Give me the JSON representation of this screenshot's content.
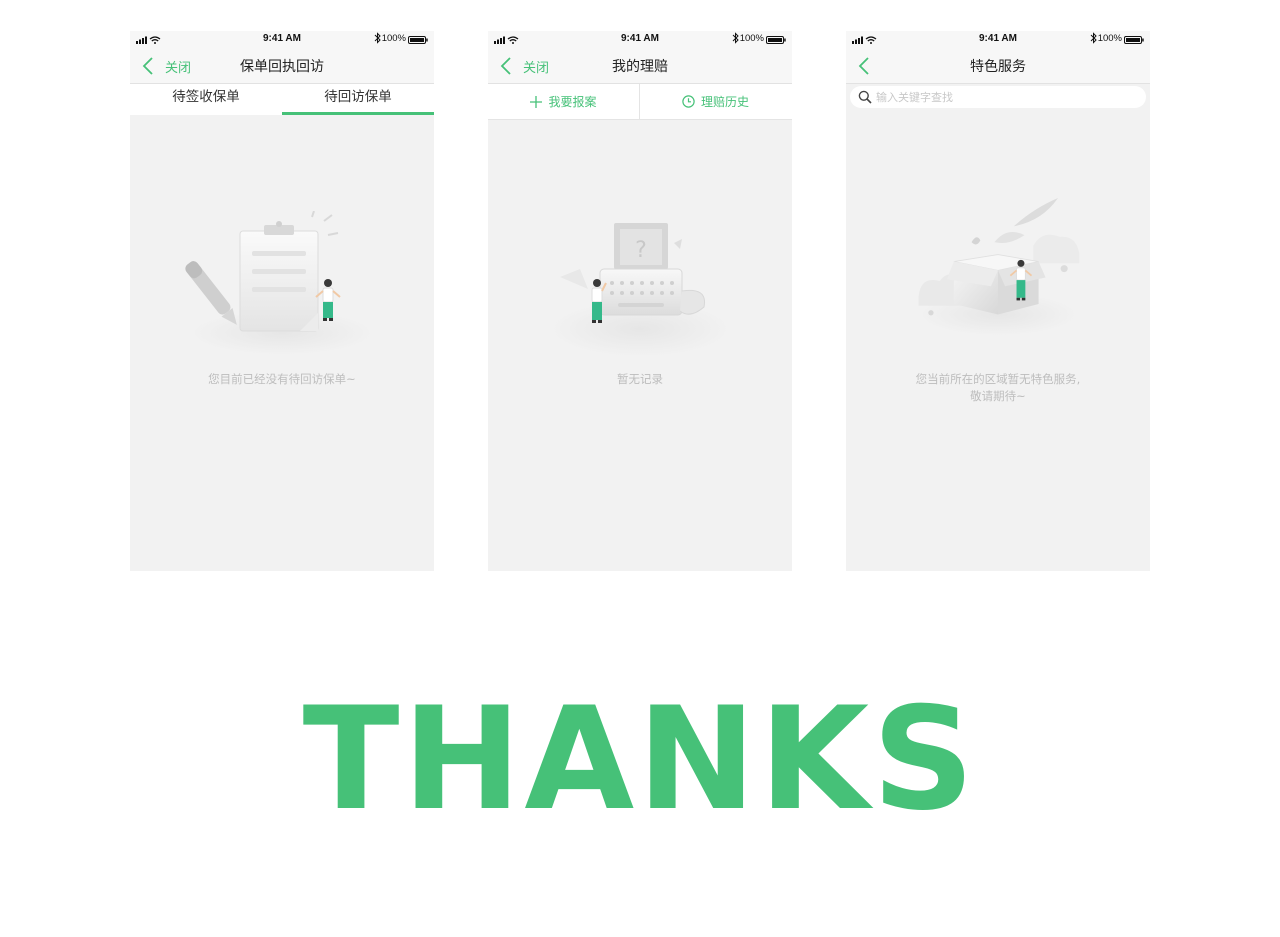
{
  "status_bar": {
    "time": "9:41 AM",
    "battery": "100%"
  },
  "colors": {
    "accent": "#46c178",
    "background": "#f2f2f2",
    "muted_text": "#bdbdbd"
  },
  "screen1": {
    "close_label": "关闭",
    "title": "保单回执回访",
    "tabs": [
      {
        "label": "待签收保单",
        "active": false
      },
      {
        "label": "待回访保单",
        "active": true
      }
    ],
    "empty_message": "您目前已经没有待回访保单~",
    "icons": {
      "back": "chevron-left-icon",
      "illustration": "clipboard-pen-illustration"
    }
  },
  "screen2": {
    "close_label": "关闭",
    "title": "我的理赔",
    "actions": [
      {
        "label": "我要报案",
        "icon": "plus-icon"
      },
      {
        "label": "理赔历史",
        "icon": "clock-icon"
      }
    ],
    "empty_message": "暂无记录",
    "icons": {
      "back": "chevron-left-icon",
      "illustration": "typewriter-illustration"
    }
  },
  "screen3": {
    "title": "特色服务",
    "search": {
      "placeholder": "输入关键字查找",
      "value": ""
    },
    "empty_message_line1": "您当前所在的区域暂无特色服务,",
    "empty_message_line2": "敬请期待~",
    "icons": {
      "back": "chevron-left-icon",
      "search": "search-icon",
      "illustration": "open-box-illustration"
    }
  },
  "footer": {
    "thanks": "THANKS"
  }
}
